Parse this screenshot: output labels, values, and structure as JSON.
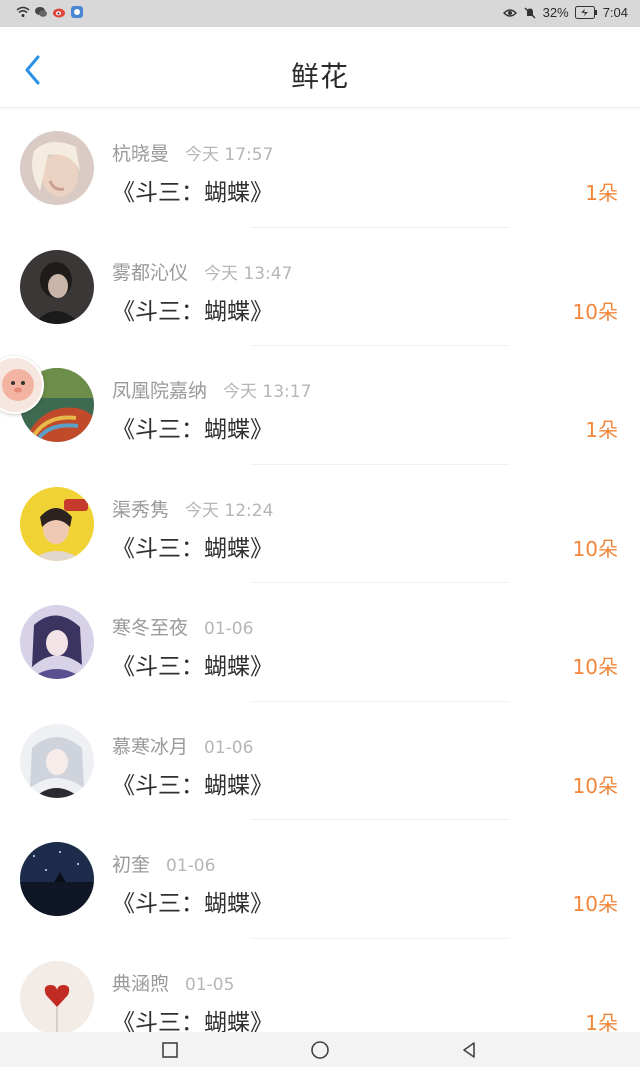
{
  "status": {
    "battery": "32%",
    "time": "7:04"
  },
  "header": {
    "title": "鲜花"
  },
  "items": [
    {
      "name": "杭晓曼",
      "time": "今天 17:57",
      "book": "《斗三：蝴蝶》",
      "count": "1朵"
    },
    {
      "name": "雾都沁仪",
      "time": "今天 13:47",
      "book": "《斗三：蝴蝶》",
      "count": "10朵"
    },
    {
      "name": "凤凰院嘉纳",
      "time": "今天 13:17",
      "book": "《斗三：蝴蝶》",
      "count": "1朵"
    },
    {
      "name": "渠秀隽",
      "time": "今天 12:24",
      "book": "《斗三：蝴蝶》",
      "count": "10朵"
    },
    {
      "name": "寒冬至夜",
      "time": "01-06",
      "book": "《斗三：蝴蝶》",
      "count": "10朵"
    },
    {
      "name": "慕寒冰月",
      "time": "01-06",
      "book": "《斗三：蝴蝶》",
      "count": "10朵"
    },
    {
      "name": "初奎",
      "time": "01-06",
      "book": "《斗三：蝴蝶》",
      "count": "10朵"
    },
    {
      "name": "典涵煦",
      "time": "01-05",
      "book": "《斗三：蝴蝶》",
      "count": "1朵"
    }
  ],
  "colors": {
    "accent_blue": "#2a8fe6",
    "count_orange": "#f2863a"
  },
  "icons": {
    "back": "back-arrow-icon",
    "nav_recent": "square-icon",
    "nav_home": "circle-icon",
    "nav_back": "triangle-icon"
  }
}
